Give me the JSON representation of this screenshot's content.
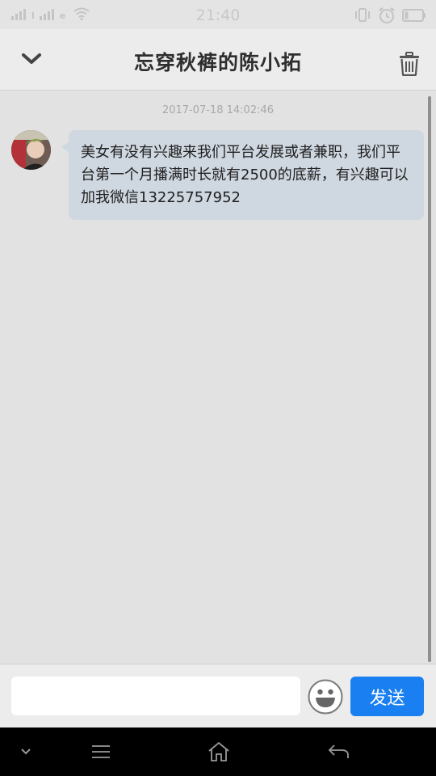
{
  "status_bar": {
    "time": "21:40",
    "signal_1_label": "l",
    "signal_2_label": "e",
    "icons": [
      "signal-icon",
      "signal-icon",
      "wifi-icon",
      "vibrate-icon",
      "alarm-icon",
      "battery-icon"
    ]
  },
  "header": {
    "title": "忘穿秋裤的陈小拓",
    "back_icon": "chevron-down-icon",
    "delete_icon": "trash-icon"
  },
  "conversation": {
    "timestamp": "2017-07-18 14:02:46",
    "messages": [
      {
        "sender": "other",
        "text": "美女有没有兴趣来我们平台发展或者兼职，我们平台第一个月播满时长就有2500的底薪，有兴趣可以加我微信13225757952"
      }
    ]
  },
  "composer": {
    "input_value": "",
    "emoji_icon": "smiley-icon",
    "send_label": "发送"
  },
  "nav_bar": {
    "icons": [
      "chevron-down-icon",
      "menu-icon",
      "home-icon",
      "back-arrow-icon"
    ]
  },
  "colors": {
    "accent": "#1a7ff0",
    "bubble": "#cfd7e0",
    "background": "#e2e2e2"
  }
}
